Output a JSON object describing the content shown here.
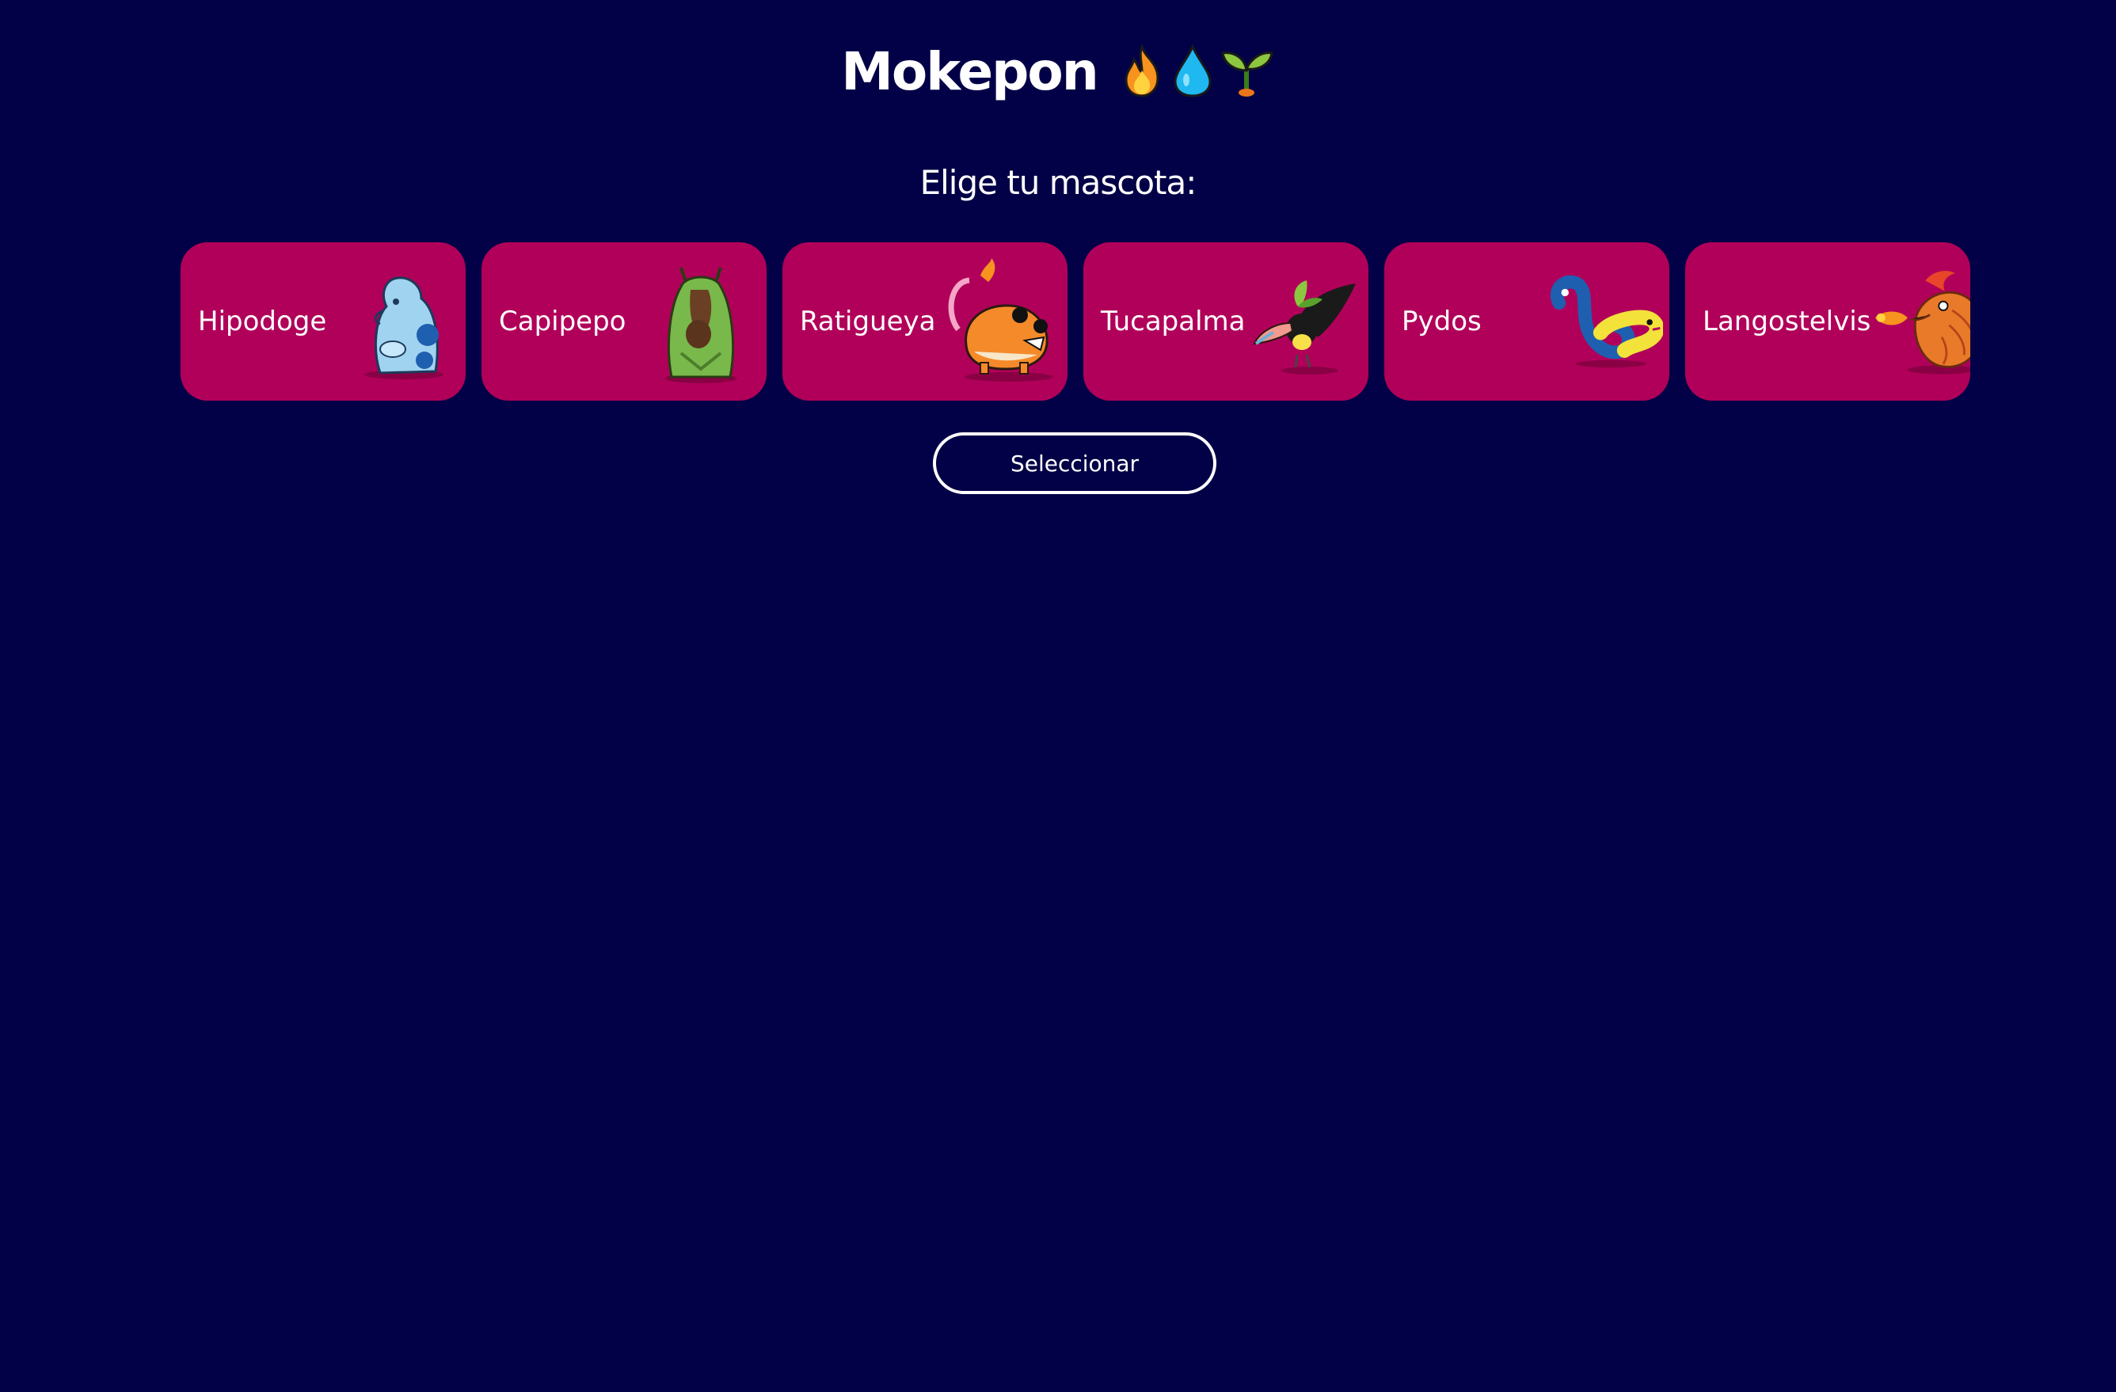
{
  "header": {
    "title": "Mokepon",
    "icons": [
      "fire-icon",
      "water-drop-icon",
      "sprout-icon"
    ]
  },
  "main": {
    "prompt": "Elige tu mascota:",
    "pets": [
      {
        "name": "Hipodoge",
        "art": "hipodoge-art"
      },
      {
        "name": "Capipepo",
        "art": "capipepo-art"
      },
      {
        "name": "Ratigueya",
        "art": "ratigueya-art"
      },
      {
        "name": "Tucapalma",
        "art": "tucapalma-art"
      },
      {
        "name": "Pydos",
        "art": "pydos-art"
      },
      {
        "name": "Langostelvis",
        "art": "langostelvis-art"
      }
    ],
    "select_label": "Seleccionar"
  },
  "colors": {
    "background": "#020046",
    "card": "#b1005a",
    "text": "#ffffff"
  }
}
